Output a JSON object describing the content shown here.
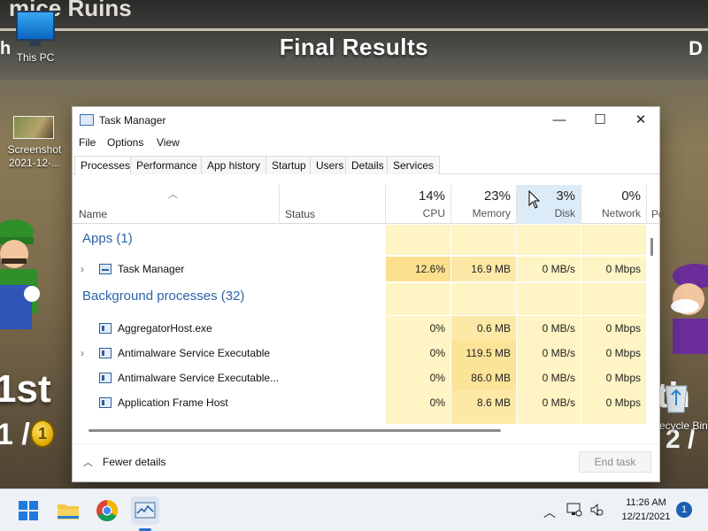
{
  "wallpaper": {
    "title": "Final Results",
    "top_left_text": "mice Ruins",
    "left_edge_char": "h",
    "right_edge_char": "D",
    "rank_left": "1st",
    "rank_left_sub": "1 /",
    "rank_right": "th",
    "rank_right_sub": "2 /",
    "coin_label": "1"
  },
  "desktop": {
    "icons": [
      {
        "label": "This PC",
        "icon": "computer-icon"
      },
      {
        "label": "Screenshot 2021-12-...",
        "icon": "image-thumbnail-icon"
      },
      {
        "label": "Recycle Bin",
        "icon": "recycle-bin-icon"
      }
    ]
  },
  "window": {
    "title": "Task Manager",
    "controls": {
      "minimize": "—",
      "maximize": "☐",
      "close": "✕"
    },
    "menu": [
      "File",
      "Options",
      "View"
    ],
    "tabs": [
      "Processes",
      "Performance",
      "App history",
      "Startup",
      "Users",
      "Details",
      "Services"
    ],
    "active_tab": "Processes",
    "columns": {
      "name": "Name",
      "status": "Status",
      "cpu": {
        "pct": "14%",
        "label": "CPU"
      },
      "memory": {
        "pct": "23%",
        "label": "Memory"
      },
      "disk": {
        "pct": "3%",
        "label": "Disk"
      },
      "network": {
        "pct": "0%",
        "label": "Network"
      },
      "power": "Po"
    },
    "groups": {
      "apps": "Apps (1)",
      "background": "Background processes (32)"
    },
    "processes": [
      {
        "name": "Task Manager",
        "expandable": true,
        "cpu": "12.6%",
        "memory": "16.9 MB",
        "disk": "0 MB/s",
        "network": "0 Mbps"
      },
      {
        "name": "AggregatorHost.exe",
        "expandable": false,
        "cpu": "0%",
        "memory": "0.6 MB",
        "disk": "0 MB/s",
        "network": "0 Mbps"
      },
      {
        "name": "Antimalware Service Executable",
        "expandable": true,
        "cpu": "0%",
        "memory": "119.5 MB",
        "disk": "0 MB/s",
        "network": "0 Mbps"
      },
      {
        "name": "Antimalware Service Executable...",
        "expandable": false,
        "cpu": "0%",
        "memory": "86.0 MB",
        "disk": "0 MB/s",
        "network": "0 Mbps"
      },
      {
        "name": "Application Frame Host",
        "expandable": false,
        "cpu": "0%",
        "memory": "8.6 MB",
        "disk": "0 MB/s",
        "network": "0 Mbps"
      }
    ],
    "footer": {
      "fewer_details": "Fewer details",
      "end_task": "End task"
    }
  },
  "taskbar": {
    "apps": [
      "windows-start-icon",
      "file-explorer-icon",
      "chrome-icon",
      "task-manager-icon"
    ],
    "clock_time": "11:26 AM",
    "clock_date": "12/21/2021",
    "notification_count": "1"
  },
  "colors": {
    "accent": "#2a64a8",
    "cpu_highlight": "#fcdf8c",
    "cell_yellow": "#fff4c4",
    "memory_yellow": "#fce9a6",
    "hover_blue": "#dcebf8"
  }
}
